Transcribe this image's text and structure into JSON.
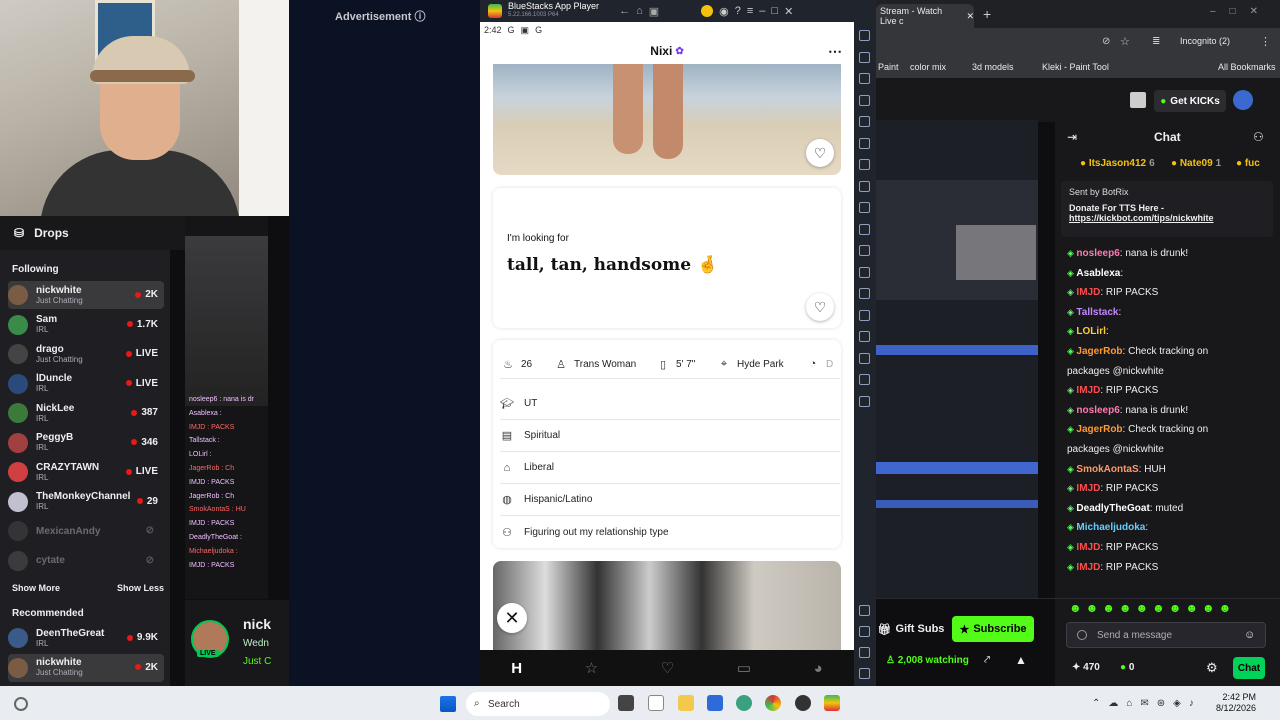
{
  "webcam": {
    "label": "streamer webcam"
  },
  "sidebar": {
    "drops_label": "Drops",
    "following_header": "Following",
    "following": [
      {
        "name": "nickwhite",
        "category": "Just Chatting",
        "count": "2K",
        "color": "#7a5c44"
      },
      {
        "name": "Sam",
        "category": "IRL",
        "count": "1.7K",
        "color": "#3a8a4a"
      },
      {
        "name": "drago",
        "category": "Just Chatting",
        "count": "LIVE",
        "color": "#444"
      },
      {
        "name": "lDuncle",
        "category": "IRL",
        "count": "LIVE",
        "color": "#2a4a7a"
      },
      {
        "name": "NickLee",
        "category": "IRL",
        "count": "387",
        "color": "#3a7a3a"
      },
      {
        "name": "PeggyB",
        "category": "IRL",
        "count": "346",
        "color": "#a04040"
      },
      {
        "name": "CRAZYTAWN",
        "category": "IRL",
        "count": "LIVE",
        "color": "#d04040"
      },
      {
        "name": "TheMonkeyChannel",
        "category": "IRL",
        "count": "29",
        "color": "#c0c0d0"
      },
      {
        "name": "MexicanAndy",
        "category": "",
        "count": "",
        "color": "#555"
      },
      {
        "name": "cytate",
        "category": "",
        "count": "",
        "color": "#666"
      }
    ],
    "show_more": "Show More",
    "show_less": "Show Less",
    "recommended_header": "Recommended",
    "recommended": [
      {
        "name": "DeenTheGreat",
        "category": "IRL",
        "count": "9.9K",
        "color": "#3a5a8a"
      },
      {
        "name": "nickwhite",
        "category": "Just Chatting",
        "count": "2K",
        "color": "#7a5c44"
      }
    ]
  },
  "ministream": {
    "lines": [
      "nosleep6 : nana is dr",
      "Asablexa : ",
      "IMJD : PACKS",
      "Tallstack : ",
      "LOLirl : ",
      "JagerRob : Ch",
      "IMJD : PACKS",
      "JagerRob : Ch",
      "SmokAontaS : HU",
      "IMJD : PACKS",
      "DeadlyTheGoat :",
      "Michaeljudoka :",
      "IMJD : PACKS"
    ],
    "channel_name": "nick",
    "channel_sub": "Wedn",
    "channel_sub2": "Just C",
    "live": "LIVE"
  },
  "ad": {
    "label": "Advertisement ⓘ"
  },
  "bluestacks": {
    "title": "BlueStacks App Player",
    "version": "5.22.166.1003 P64",
    "time": "2:42",
    "profile_name": "Nixi",
    "looking_label": "I'm looking for",
    "looking_value": "tall, tan, handsome 🤞",
    "chips": [
      "26",
      "Trans Woman",
      "5' 7\"",
      "Hyde Park",
      "D"
    ],
    "rows": [
      "UT",
      "Spiritual",
      "Liberal",
      "Hispanic/Latino",
      "Figuring out my relationship type"
    ]
  },
  "browser": {
    "tab_title": "Stream - Watch Live c",
    "bookmarks": [
      "Paint",
      "color mix",
      "3d models",
      "Kleki - Paint Tool",
      "All Bookmarks"
    ],
    "incognito": "Incognito (2)"
  },
  "kick": {
    "get_kicks": "Get KICKs",
    "chat_title": "Chat",
    "gifters": [
      {
        "name": "ItsJason412",
        "count": "6"
      },
      {
        "name": "Nate09",
        "count": "1"
      },
      {
        "name": "fuc",
        "count": ""
      }
    ],
    "pinned_sender": "Sent by BotRix",
    "pinned_text": "Donate For TTS Here -",
    "pinned_link": "https://kickbot.com/tips/nickwhite",
    "messages": [
      {
        "user": "nosleep6",
        "text": ": nana is drunk!",
        "color": "#ff7ab0"
      },
      {
        "user": "Asablexa",
        "text": ":",
        "color": "#fff"
      },
      {
        "user": "IMJD",
        "text": ": RIP PACKS",
        "color": "#ff4d4d"
      },
      {
        "user": "Tallstack",
        "text": ":",
        "color": "#c586ff"
      },
      {
        "user": "LOLirl",
        "text": ":",
        "color": "#ffcc33"
      },
      {
        "user": "JagerRob",
        "text": ": Check tracking on",
        "color": "#ff9933"
      },
      {
        "user": "",
        "text": "packages @nickwhite",
        "color": "#fff"
      },
      {
        "user": "IMJD",
        "text": ": RIP PACKS",
        "color": "#ff4d4d"
      },
      {
        "user": "nosleep6",
        "text": ": nana is drunk!",
        "color": "#ff7ab0"
      },
      {
        "user": "JagerRob",
        "text": ": Check tracking on",
        "color": "#ff9933"
      },
      {
        "user": "",
        "text": "packages @nickwhite",
        "color": "#fff"
      },
      {
        "user": "SmokAontaS",
        "text": ": HUH",
        "color": "#ff9966"
      },
      {
        "user": "IMJD",
        "text": ": RIP PACKS",
        "color": "#ff4d4d"
      },
      {
        "user": "DeadlyTheGoat",
        "text": ": muted",
        "color": "#fff"
      },
      {
        "user": "Michaeljudoka",
        "text": ":",
        "color": "#66ccff"
      },
      {
        "user": "IMJD",
        "text": ": RIP PACKS",
        "color": "#ff4d4d"
      },
      {
        "user": "IMJD",
        "text": ": RIP PACKS",
        "color": "#ff4d4d"
      }
    ],
    "gift_subs": "Gift Subs",
    "subscribe": "Subscribe",
    "watching": "2,008 watching",
    "send_placeholder": "Send a message",
    "points": "470",
    "kicks_count": "0",
    "chat_button": "Chat"
  },
  "taskbar": {
    "search": "Search",
    "time": "2:42 PM",
    "date": "8/12/2026"
  }
}
